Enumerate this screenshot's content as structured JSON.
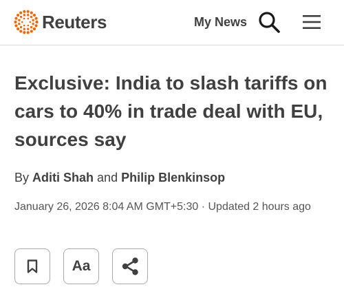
{
  "header": {
    "logo_text": "Reuters",
    "my_news_label": "My News",
    "brand_color": "#fa6400",
    "icons": [
      "search-icon",
      "hamburger-menu-icon"
    ]
  },
  "article": {
    "headline": "Exclusive: India to slash tariffs on cars to 40% in trade deal with EU, sources say",
    "byline": {
      "prefix": "By",
      "author1": "Aditi Shah",
      "conjunction": "and",
      "author2": "Philip Blenkinsop"
    },
    "dateline": "January 26, 2026 8:04 AM GMT+5:30 · Updated 2 hours ago"
  },
  "actions": {
    "bookmark_icon": "bookmark-icon",
    "text_size_label": "Aa",
    "share_icon": "share-icon"
  }
}
